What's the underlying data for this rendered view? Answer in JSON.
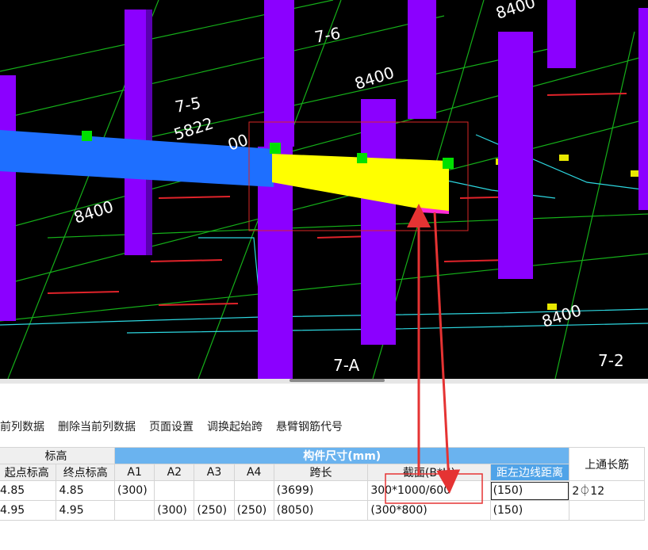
{
  "viewport": {
    "grid_labels": [
      "7-6",
      "7-5",
      "7-A",
      "7-2"
    ],
    "dimension_labels": [
      "8400",
      "8400",
      "8400",
      "8400",
      "8400"
    ],
    "partial_labels": [
      "5822",
      "00"
    ],
    "colors": {
      "column": "#8b00ff",
      "selected_beam": "#ffff00",
      "beam": "#1e6fff",
      "grip": "#00ff00"
    }
  },
  "toolbar": {
    "items": [
      "前列数据",
      "删除当前列数据",
      "页面设置",
      "调换起始跨",
      "悬臂钢筋代号"
    ]
  },
  "table": {
    "group_headers": {
      "elevation": "标高",
      "size": "构件尺寸(mm)",
      "top_rebar": "上通长筋"
    },
    "col_headers": {
      "start_elev": "起点标高",
      "end_elev": "终点标高",
      "a1": "A1",
      "a2": "A2",
      "a3": "A3",
      "a4": "A4",
      "span_len": "跨长",
      "section": "截面(B*H)",
      "left_dist": "距左边线距离"
    },
    "rows": [
      {
        "c0": "4.85",
        "start": "4.85",
        "a1": "(300)",
        "a2": "",
        "a3": "",
        "a4": "",
        "span": "(3699)",
        "section": "300*1000/600",
        "left": "(150)",
        "top": "2⏀12"
      },
      {
        "c0": "4.95",
        "start": "4.95",
        "a1": "",
        "a2": "(300)",
        "a3": "(250)",
        "a4": "(250)",
        "span": "(8050)",
        "section": "(300*800)",
        "left": "(150)",
        "top": ""
      }
    ]
  }
}
